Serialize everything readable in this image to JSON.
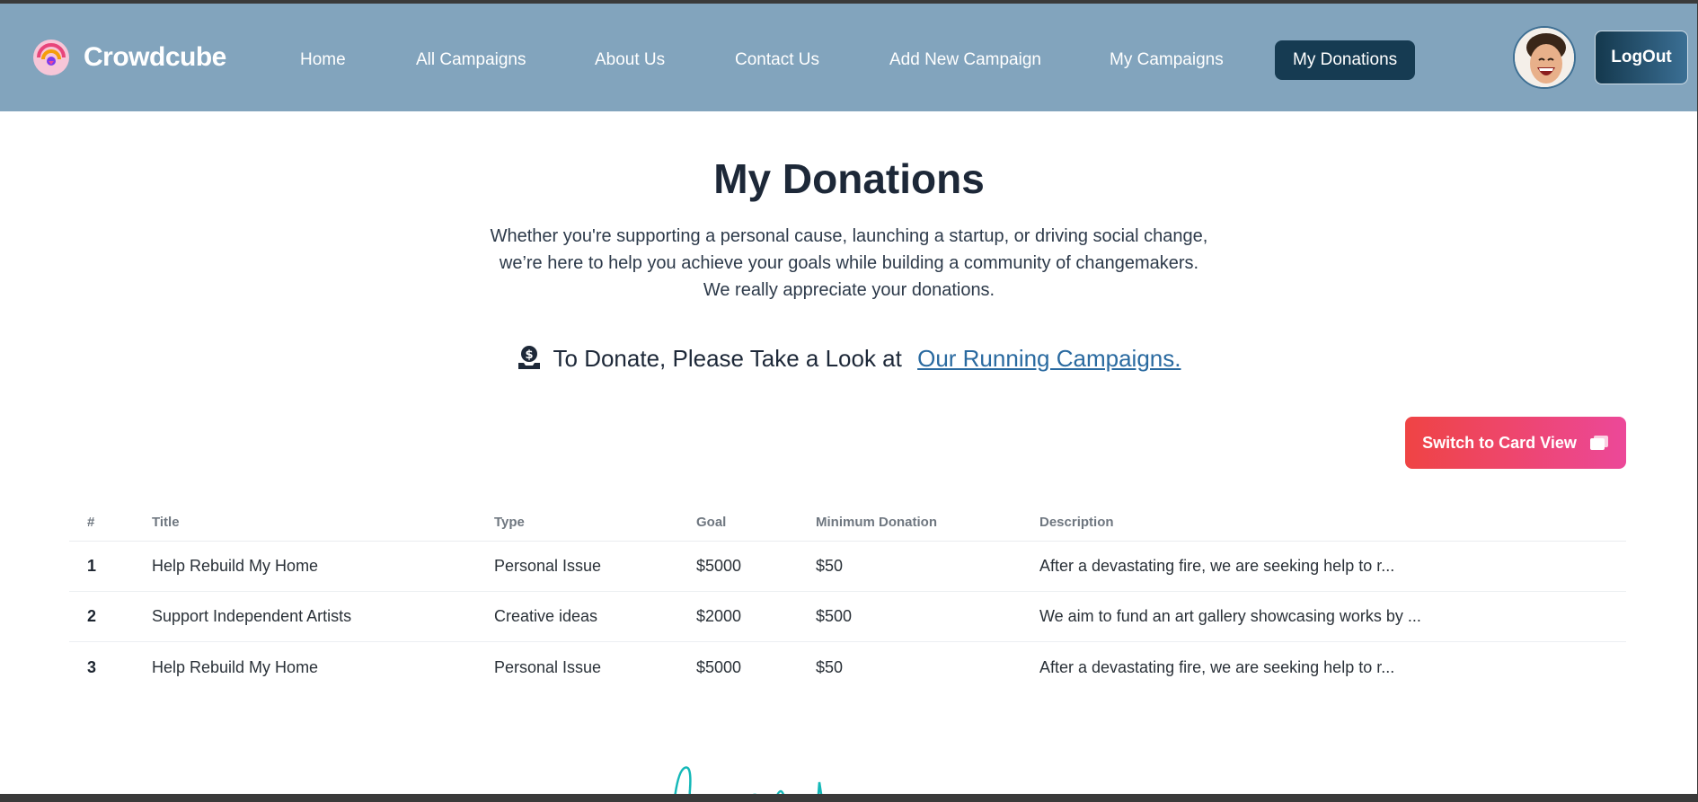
{
  "nav": {
    "brand": "Crowdcube",
    "links": [
      {
        "label": "Home"
      },
      {
        "label": "All Campaigns"
      },
      {
        "label": "About Us"
      },
      {
        "label": "Contact Us"
      },
      {
        "label": "Add New Campaign"
      },
      {
        "label": "My Campaigns"
      },
      {
        "label": "My Donations",
        "active": true
      }
    ],
    "logout_label": "LogOut"
  },
  "page": {
    "title": "My Donations",
    "subtitle_lines": [
      "Whether you're supporting a personal cause, launching a startup, or driving social change,",
      "we’re here to help you achieve your goals while building a community of changemakers.",
      "We really appreciate your donations."
    ],
    "cta_text": "To Donate, Please Take a Look at",
    "cta_link": "Our Running Campaigns.",
    "switch_button": "Switch to Card View"
  },
  "table": {
    "headers": [
      "#",
      "Title",
      "Type",
      "Goal",
      "Minimum Donation",
      "Description"
    ],
    "rows": [
      [
        "1",
        "Help Rebuild My Home",
        "Personal Issue",
        "$5000",
        "$50",
        "After a devastating fire, we are seeking help to r..."
      ],
      [
        "2",
        "Support Independent Artists",
        "Creative ideas",
        "$2000",
        "$500",
        "We aim to fund an art gallery showcasing works by ..."
      ],
      [
        "3",
        "Help Rebuild My Home",
        "Personal Issue",
        "$5000",
        "$50",
        "After a devastating fire, we are seeking help to r..."
      ]
    ]
  },
  "colors": {
    "nav_bg": "#82a4bd",
    "active_nav": "#163b52",
    "link": "#2a6aa0",
    "switch_gradient": [
      "#ef4444",
      "#ec4899"
    ]
  },
  "icons": {
    "brand": "crowdcube-logo-icon",
    "cta": "hand-coin-icon",
    "switch": "card-view-icon",
    "avatar": "user-avatar"
  }
}
